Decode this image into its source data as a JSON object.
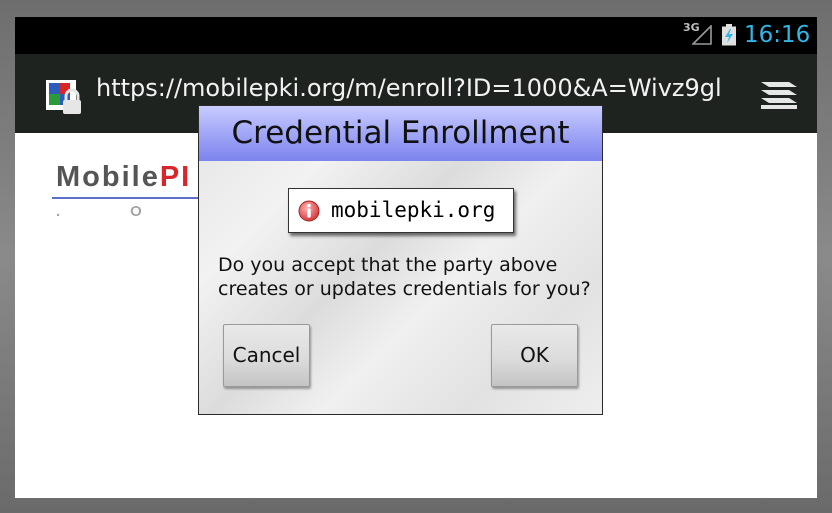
{
  "status_bar": {
    "network": "3G",
    "time": "16:16",
    "clock_color": "#33b5e5"
  },
  "address_bar": {
    "site_icon": "secure-site-icon",
    "url": "https://mobilepki.org/m/enroll?ID=1000&A=Wivz9gl",
    "menu_icon": "tabs-menu-icon"
  },
  "page": {
    "logo": {
      "text_main": "Mobile",
      "text_accent": "PI",
      "subtitle": ".ORG"
    }
  },
  "dialog": {
    "title": "Credential Enrollment",
    "title_color": "#a5aaf7",
    "origin": "mobilepki.org",
    "origin_icon": "info-icon",
    "question": "Do you accept that the party above creates or updates credentials for you?",
    "cancel_label": "Cancel",
    "ok_label": "OK"
  }
}
